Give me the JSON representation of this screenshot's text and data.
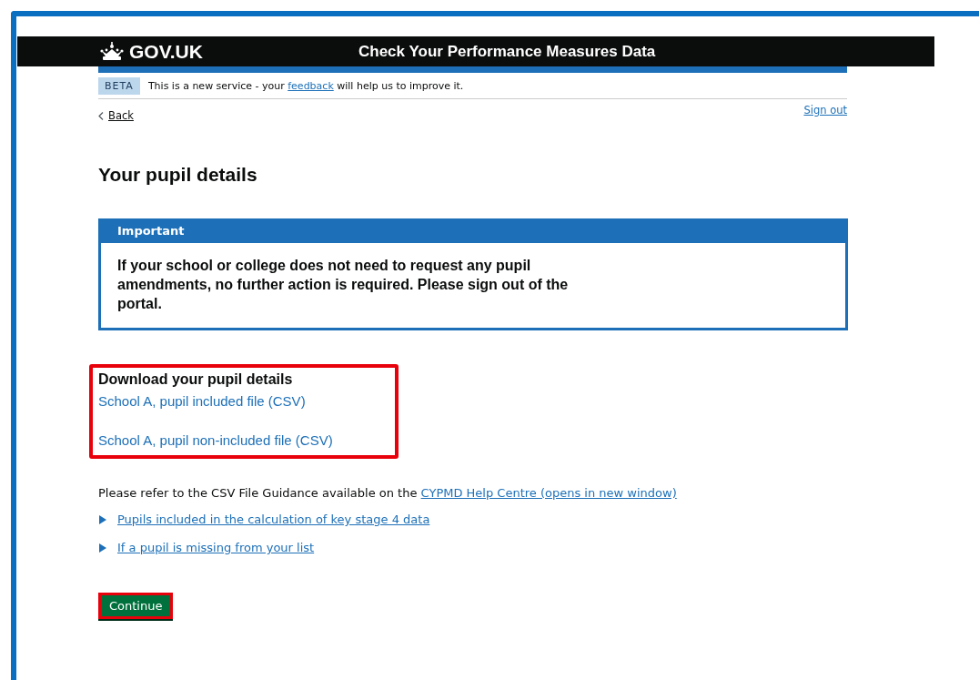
{
  "header": {
    "logo": "GOV.UK",
    "service_name": "Check Your Performance Measures Data"
  },
  "phase_banner": {
    "tag": "BETA",
    "text_before": "This is a new service - your",
    "link": "feedback",
    "text_after": "will help us to improve it."
  },
  "back_link": "Back",
  "sign_out": "Sign out",
  "heading": "Your pupil details",
  "notice": {
    "title": "Important",
    "text": "If your school or college does not need to request any pupil amendments, no further action is required. Please sign out of the portal."
  },
  "downloads": {
    "heading": "Download your pupil details",
    "highlighted": true,
    "links": [
      "School A, pupil included file (CSV)",
      "School A, pupil non-included file (CSV)"
    ]
  },
  "guidance": {
    "text": "Please refer to the CSV File Guidance available on the",
    "link": "CYPMD Help Centre (opens in new window)"
  },
  "details": [
    {
      "label": "Pupils included in the calculation of key stage 4 data",
      "expanded": false
    },
    {
      "label": "If a pupil is missing from your list",
      "expanded": false
    }
  ],
  "continue_button": {
    "label": "Continue",
    "highlighted": true
  }
}
